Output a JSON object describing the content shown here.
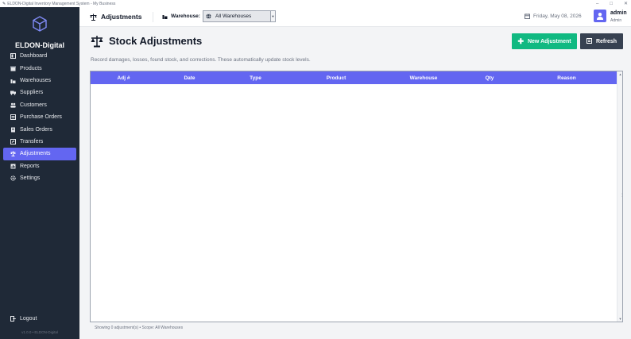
{
  "window": {
    "title": "ELDON-Digital Inventory Management System - My Business",
    "minimize_glyph": "–",
    "maximize_glyph": "□",
    "close_glyph": "✕"
  },
  "sidebar": {
    "brand": "ELDON-Digital",
    "items": [
      {
        "label": "Dashboard",
        "icon": "dashboard-icon"
      },
      {
        "label": "Products",
        "icon": "box-icon"
      },
      {
        "label": "Warehouses",
        "icon": "warehouse-icon"
      },
      {
        "label": "Suppliers",
        "icon": "truck-icon"
      },
      {
        "label": "Customers",
        "icon": "users-icon"
      },
      {
        "label": "Purchase Orders",
        "icon": "cart-icon"
      },
      {
        "label": "Sales Orders",
        "icon": "receipt-icon"
      },
      {
        "label": "Transfers",
        "icon": "transfer-icon"
      },
      {
        "label": "Adjustments",
        "icon": "scale-icon",
        "active": true
      },
      {
        "label": "Reports",
        "icon": "report-icon"
      },
      {
        "label": "Settings",
        "icon": "gear-icon"
      }
    ],
    "logout_label": "Logout",
    "footer": "v1.0.0 • ELDON-Digital"
  },
  "topbar": {
    "page_title": "Adjustments",
    "warehouse_label": "Warehouse:",
    "warehouse_value": "All Warehouses",
    "date": "Friday, May 08, 2026",
    "user_name": "admin",
    "user_role": "Admin"
  },
  "main": {
    "title": "Stock Adjustments",
    "description": "Record damages, losses, found stock, and corrections. These automatically update stock levels.",
    "new_button_label": "New Adjustment",
    "refresh_button_label": "Refresh",
    "table": {
      "columns": [
        "Adj #",
        "Date",
        "Type",
        "Product",
        "Warehouse",
        "Qty",
        "Reason"
      ],
      "rows": []
    },
    "status": "Showing 0 adjustment(s) • Scope: All Warehouses"
  },
  "colors": {
    "sidebar_bg": "#1f2937",
    "accent": "#6366f1",
    "new_button": "#10b981",
    "refresh_button": "#374151"
  }
}
